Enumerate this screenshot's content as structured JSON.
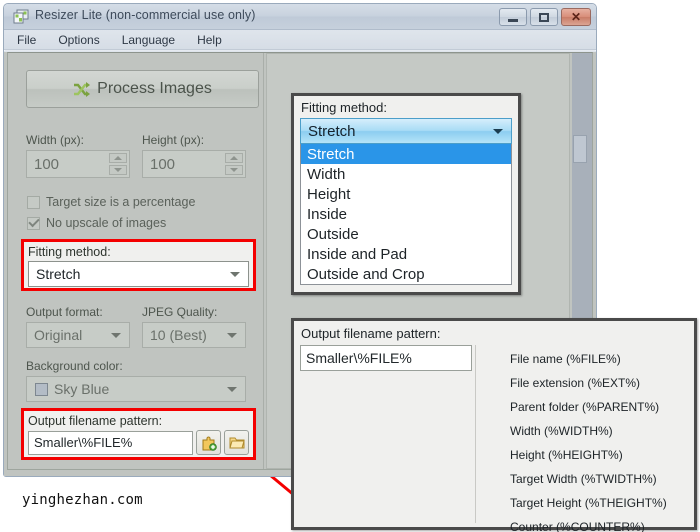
{
  "window": {
    "title": "Resizer Lite (non-commercial use only)",
    "app_icon": "app-images-icon",
    "controls": {
      "minimize": "minimize-button",
      "maximize": "maximize-button",
      "close": "close-button"
    },
    "menu": [
      "File",
      "Options",
      "Language",
      "Help"
    ]
  },
  "left_panel": {
    "process_button": {
      "label": "Process Images",
      "icon": "shuffle-arrows-icon"
    },
    "width_field": {
      "label": "Width (px):",
      "value": "100"
    },
    "height_field": {
      "label": "Height (px):",
      "value": "100"
    },
    "checkboxes": [
      {
        "label": "Target size is a percentage",
        "checked": false
      },
      {
        "label": "No upscale of images",
        "checked": true
      }
    ],
    "fitting_method": {
      "label": "Fitting method:",
      "value": "Stretch"
    },
    "output_format": {
      "label": "Output format:",
      "value": "Original"
    },
    "jpeg_quality": {
      "label": "JPEG Quality:",
      "value": "10 (Best)"
    },
    "background_color": {
      "label": "Background color:",
      "value": "Sky Blue",
      "swatch": "#b3bcc6"
    },
    "output_pattern": {
      "label": "Output filename pattern:",
      "value": "Smaller\\%FILE%",
      "insert_button": "insert-pattern-icon",
      "browse_button": "folder-browse-icon"
    }
  },
  "popup_fitting": {
    "label": "Fitting method:",
    "selected": "Stretch",
    "options": [
      "Stretch",
      "Width",
      "Height",
      "Inside",
      "Outside",
      "Inside and Pad",
      "Outside and Crop"
    ]
  },
  "popup_pattern": {
    "label": "Output filename pattern:",
    "value": "Smaller\\%FILE%",
    "items": [
      "File name (%FILE%)",
      "File extension (%EXT%)",
      "Parent folder (%PARENT%)",
      "Width (%WIDTH%)",
      "Height (%HEIGHT%)",
      "Target Width (%TWIDTH%)",
      "Target Height (%THEIGHT%)",
      "Counter (%COUNTER%)"
    ]
  },
  "watermark": "yinghezhan.com",
  "colors": {
    "callout": "#f40000",
    "highlight": "#2a95e8",
    "accent_green": "#7ba23f"
  }
}
